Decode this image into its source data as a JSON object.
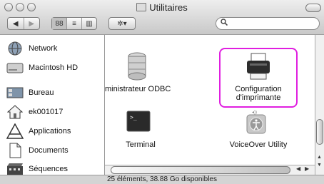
{
  "window": {
    "title": "Utilitaires"
  },
  "toolbar": {
    "nav": [
      "◀",
      "▶"
    ],
    "views": [
      "88",
      "≡",
      "▥"
    ],
    "action": "✲▾",
    "search_placeholder": ""
  },
  "sidebar": {
    "items": [
      {
        "label": "Network",
        "icon": "globe-icon"
      },
      {
        "label": "Macintosh HD",
        "icon": "hard-drive-icon"
      },
      {
        "label": "Bureau",
        "icon": "desktop-icon"
      },
      {
        "label": "ek001017",
        "icon": "home-icon"
      },
      {
        "label": "Applications",
        "icon": "applications-icon"
      },
      {
        "label": "Documents",
        "icon": "documents-icon"
      },
      {
        "label": "Séquences",
        "icon": "movies-icon"
      }
    ]
  },
  "files": [
    {
      "label": "ministrateur ODBC",
      "icon": "odbc-database-icon"
    },
    {
      "label": "Configuration d'imprimante",
      "icon": "printer-icon",
      "highlighted": true
    },
    {
      "label": "Terminal",
      "icon": "terminal-icon"
    },
    {
      "label": "VoiceOver Utility",
      "icon": "voiceover-icon"
    }
  ],
  "status": {
    "text": "25 éléments, 38.88 Go disponibles"
  },
  "colors": {
    "highlight": "#e01ee0"
  }
}
